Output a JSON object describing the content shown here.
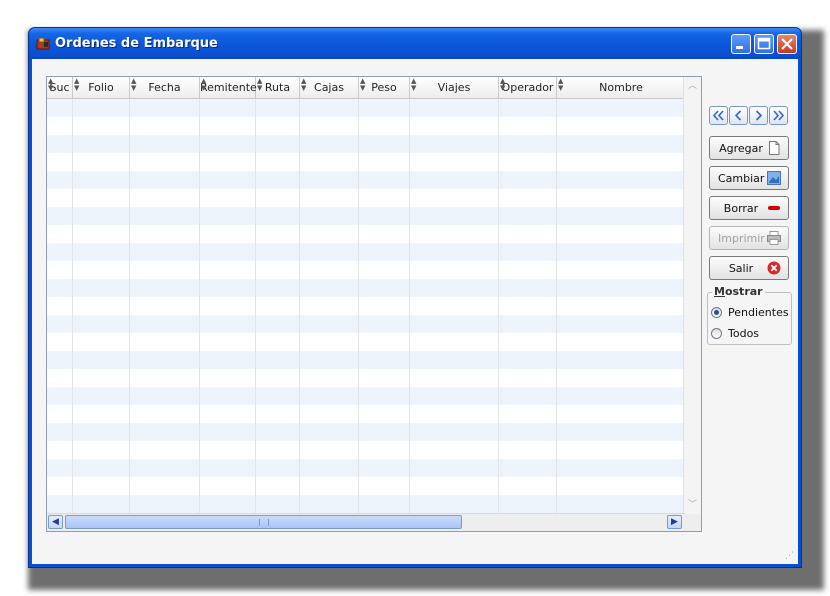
{
  "window": {
    "title": "Ordenes de Embarque"
  },
  "table": {
    "columns": [
      "Suc",
      "Folio",
      "Fecha",
      "Remitente",
      "Ruta",
      "Cajas",
      "Peso",
      "Viajes",
      "Operador",
      "Nombre"
    ],
    "rows": []
  },
  "navigation": {
    "first_icon": "double-left-chevron-icon",
    "prev_icon": "left-chevron-icon",
    "next_icon": "right-chevron-icon",
    "last_icon": "double-right-chevron-icon"
  },
  "actions": {
    "agregar": "Agregar",
    "cambiar": "Cambiar",
    "borrar": "Borrar",
    "imprimir": "Imprimir",
    "salir": "Salir"
  },
  "mostrar": {
    "title": "Mostrar",
    "pendientes": "Pendientes",
    "todos": "Todos",
    "selected": "Pendientes"
  },
  "colors": {
    "titlebar": "#0b55d9",
    "row_alt": "#eef4fb",
    "borrar_icon": "#d40000",
    "salir_icon": "#d42a2a"
  }
}
